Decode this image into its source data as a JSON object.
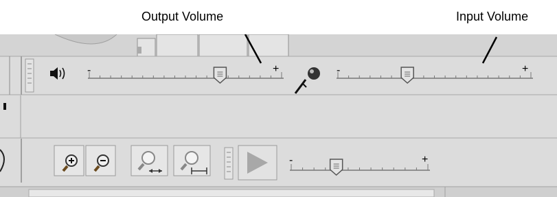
{
  "annotations": {
    "output_volume": "Output Volume",
    "input_volume": "Input Volume"
  },
  "mixer_toolbar": {
    "output_slider": {
      "icon": "speaker-icon",
      "min_label": "-",
      "max_label": "+",
      "level": 0.68
    },
    "input_slider": {
      "icon": "microphone-icon",
      "min_label": "-",
      "max_label": "+",
      "level": 0.36
    }
  },
  "view_toolbar": {
    "buttons": [
      "zoom-in-icon",
      "zoom-out-icon",
      "fit-selection-icon",
      "fit-project-icon"
    ]
  },
  "transcription_toolbar": {
    "play_icon": "play-icon",
    "speed_slider": {
      "min_label": "-",
      "max_label": "+",
      "level": 0.33
    }
  },
  "colors": {
    "toolbar_bg": "#dcdcdc",
    "thumb": "#e4e4e4",
    "play_disabled": "#a8a8a8",
    "magnifier_handle": "#6a4a1e"
  }
}
